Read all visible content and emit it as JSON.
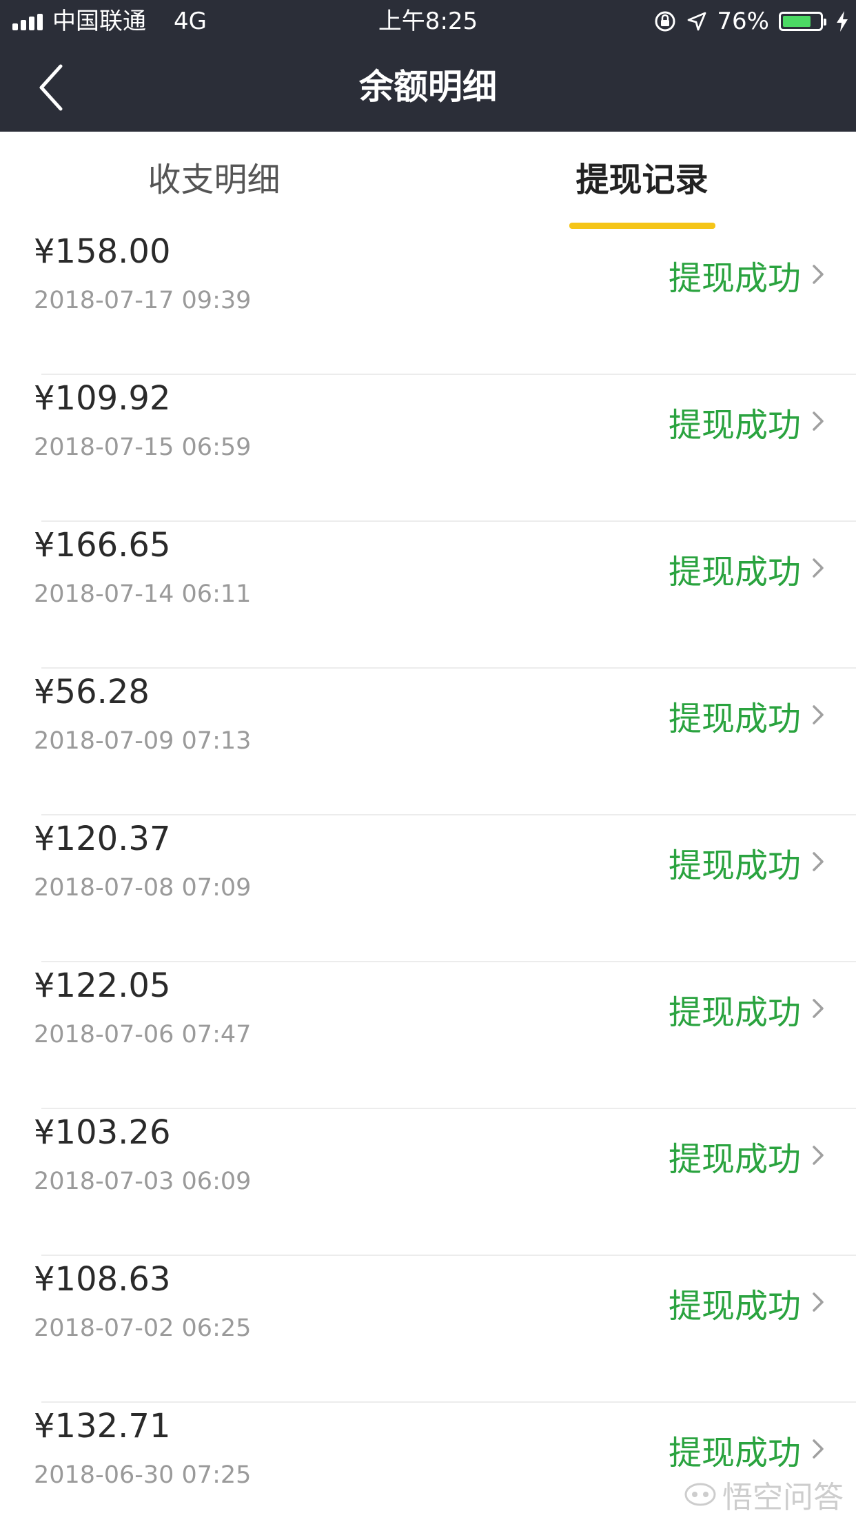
{
  "status_bar": {
    "carrier": "中国联通",
    "network": "4G",
    "time": "上午8:25",
    "battery_percent": "76%",
    "battery_level": 0.76,
    "icons": [
      "signal-icon",
      "rotation-lock-icon",
      "location-arrow-icon",
      "battery-icon",
      "charging-bolt-icon"
    ]
  },
  "nav": {
    "title": "余额明细",
    "back_icon": "chevron-left-icon"
  },
  "tabs": [
    {
      "label": "收支明细",
      "active": false
    },
    {
      "label": "提现记录",
      "active": true
    }
  ],
  "colors": {
    "header_bg": "#2b2e38",
    "tab_indicator": "#f5c518",
    "status_success": "#2aa33f",
    "battery_green": "#4cd964"
  },
  "records": [
    {
      "amount": "¥158.00",
      "time": "2018-07-17 09:39",
      "status": "提现成功"
    },
    {
      "amount": "¥109.92",
      "time": "2018-07-15 06:59",
      "status": "提现成功"
    },
    {
      "amount": "¥166.65",
      "time": "2018-07-14 06:11",
      "status": "提现成功"
    },
    {
      "amount": "¥56.28",
      "time": "2018-07-09 07:13",
      "status": "提现成功"
    },
    {
      "amount": "¥120.37",
      "time": "2018-07-08 07:09",
      "status": "提现成功"
    },
    {
      "amount": "¥122.05",
      "time": "2018-07-06 07:47",
      "status": "提现成功"
    },
    {
      "amount": "¥103.26",
      "time": "2018-07-03 06:09",
      "status": "提现成功"
    },
    {
      "amount": "¥108.63",
      "time": "2018-07-02 06:25",
      "status": "提现成功"
    },
    {
      "amount": "¥132.71",
      "time": "2018-06-30 07:25",
      "status": "提现成功"
    }
  ],
  "watermark": {
    "text": "悟空问答",
    "icon": "wukong-logo-icon"
  }
}
